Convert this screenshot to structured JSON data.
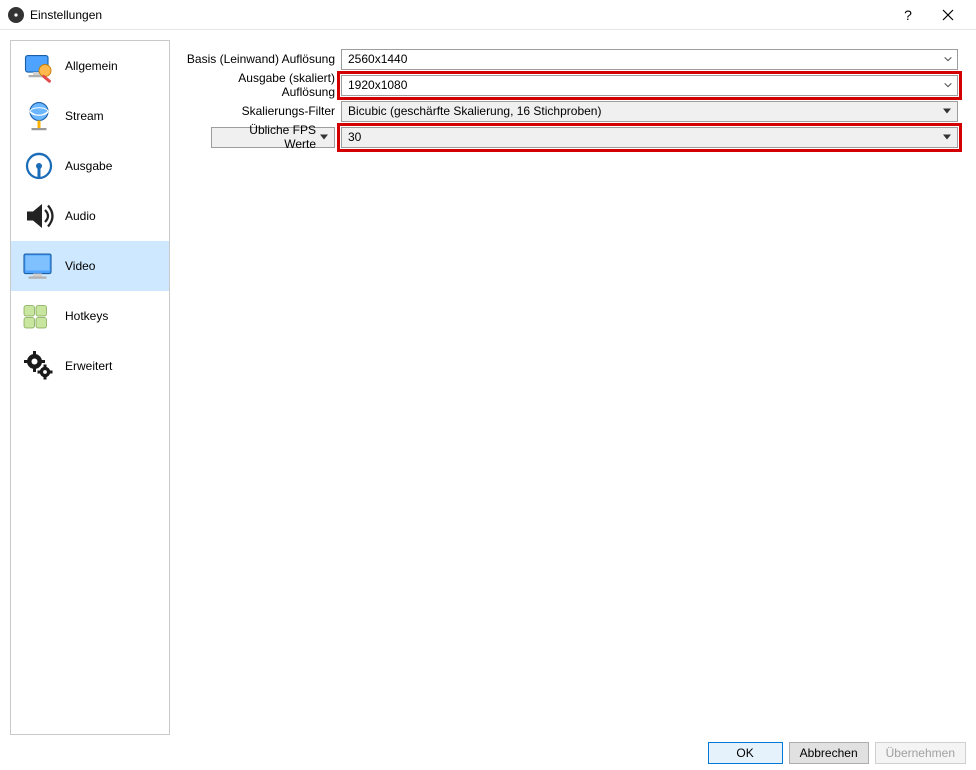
{
  "window": {
    "title": "Einstellungen"
  },
  "sidebar": {
    "items": [
      {
        "label": "Allgemein"
      },
      {
        "label": "Stream"
      },
      {
        "label": "Ausgabe"
      },
      {
        "label": "Audio"
      },
      {
        "label": "Video"
      },
      {
        "label": "Hotkeys"
      },
      {
        "label": "Erweitert"
      }
    ]
  },
  "form": {
    "base_res_label": "Basis (Leinwand) Auflösung",
    "base_res_value": "2560x1440",
    "output_res_label": "Ausgabe (skaliert) Auflösung",
    "output_res_value": "1920x1080",
    "scale_filter_label": "Skalierungs-Filter",
    "scale_filter_value": "Bicubic (geschärfte Skalierung, 16 Stichproben)",
    "fps_mode_label": "Übliche FPS Werte",
    "fps_value": "30"
  },
  "buttons": {
    "ok": "OK",
    "cancel": "Abbrechen",
    "apply": "Übernehmen"
  }
}
